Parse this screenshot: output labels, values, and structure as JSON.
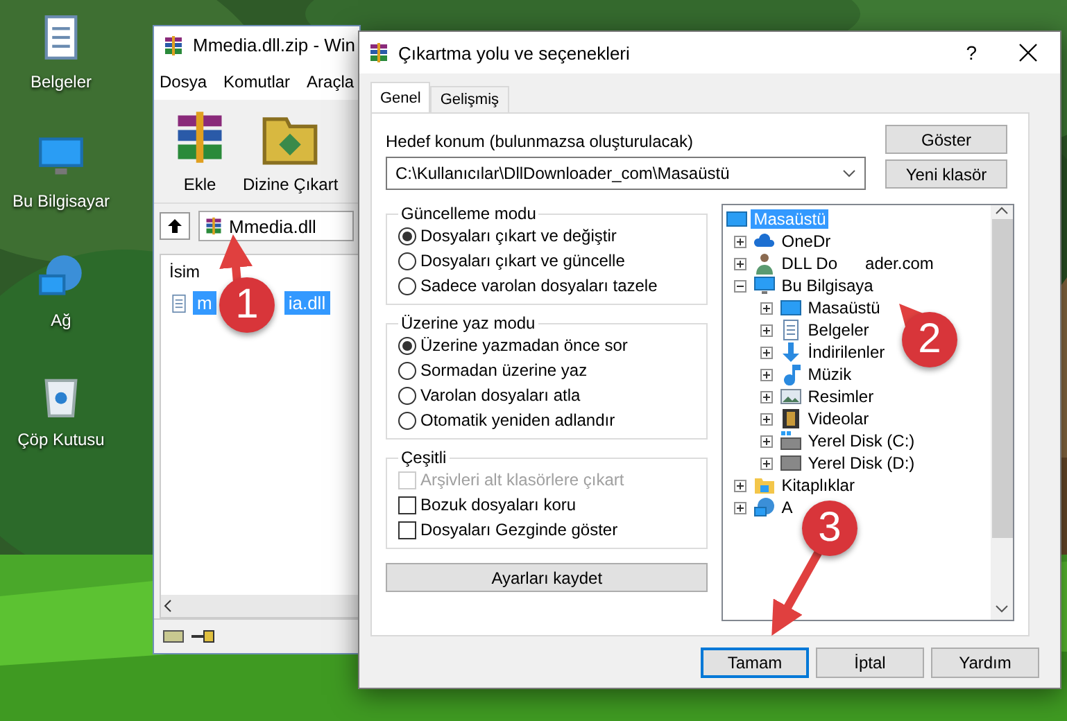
{
  "desktop_icons": [
    {
      "label": "Belgeler",
      "kind": "documents"
    },
    {
      "label": "Bu Bilgisayar",
      "kind": "computer"
    },
    {
      "label": "Ağ",
      "kind": "network"
    },
    {
      "label": "Çöp Kutusu",
      "kind": "recycle"
    }
  ],
  "archive_window": {
    "title": "Mmedia.dll.zip - Win",
    "menu": [
      "Dosya",
      "Komutlar",
      "Araçla"
    ],
    "toolbar": [
      {
        "label": "Ekle",
        "kind": "add"
      },
      {
        "label": "Dizine Çıkart",
        "kind": "extract"
      }
    ],
    "address": "Mmedia.dll",
    "column": "İsim",
    "files": [
      {
        "name": "m",
        "name_tail": "ia.dll",
        "selected": true
      }
    ]
  },
  "dialog": {
    "title": "Çıkartma yolu ve seçenekleri",
    "help": "?",
    "tabs": [
      {
        "label": "Genel",
        "selected": true
      },
      {
        "label": "Gelişmiş",
        "selected": false
      }
    ],
    "destination_label": "Hedef konum (bulunmazsa oluşturulacak)",
    "destination": "C:\\Kullanıcılar\\DllDownloader_com\\Masaüstü",
    "side_buttons": [
      "Göster",
      "Yeni klasör"
    ],
    "groups": [
      {
        "title": "Güncelleme modu",
        "options": [
          {
            "kind": "radio",
            "label": "Dosyaları çıkart ve değiştir",
            "checked": true,
            "disabled": false
          },
          {
            "kind": "radio",
            "label": "Dosyaları çıkart ve güncelle",
            "checked": false,
            "disabled": false
          },
          {
            "kind": "radio",
            "label": "Sadece varolan dosyaları tazele",
            "checked": false,
            "disabled": false
          }
        ]
      },
      {
        "title": "Üzerine yaz modu",
        "options": [
          {
            "kind": "radio",
            "label": "Üzerine yazmadan önce sor",
            "checked": true,
            "disabled": false
          },
          {
            "kind": "radio",
            "label": "Sormadan üzerine yaz",
            "checked": false,
            "disabled": false
          },
          {
            "kind": "radio",
            "label": "Varolan dosyaları atla",
            "checked": false,
            "disabled": false
          },
          {
            "kind": "radio",
            "label": "Otomatik yeniden adlandır",
            "checked": false,
            "disabled": false
          }
        ]
      },
      {
        "title": "Çeşitli",
        "options": [
          {
            "kind": "checkbox",
            "label": "Arşivleri alt klasörlere çıkart",
            "checked": false,
            "disabled": true
          },
          {
            "kind": "checkbox",
            "label": "Bozuk dosyaları koru",
            "checked": false,
            "disabled": false
          },
          {
            "kind": "checkbox",
            "label": "Dosyaları Gezginde göster",
            "checked": false,
            "disabled": false
          }
        ]
      }
    ],
    "save_button": "Ayarları kaydet",
    "tree": {
      "label": "Masaüstü",
      "kind": "desktop",
      "selected": true,
      "children": [
        {
          "label": "OneDr",
          "kind": "cloud",
          "expanded": false,
          "selected": false
        },
        {
          "label": "DLL Do",
          "label_tail": "ader.com",
          "kind": "user",
          "expanded": false,
          "selected": false
        },
        {
          "label": "Bu Bilgisaya",
          "kind": "computer",
          "expanded": true,
          "selected": false,
          "children": [
            {
              "label": "Masaüstü",
              "kind": "desktop",
              "expanded": false,
              "selected": false
            },
            {
              "label": "Belgeler",
              "kind": "documents",
              "expanded": false,
              "selected": false
            },
            {
              "label": "İndirilenler",
              "kind": "download",
              "expanded": false,
              "selected": false
            },
            {
              "label": "Müzik",
              "kind": "music",
              "expanded": false,
              "selected": false
            },
            {
              "label": "Resimler",
              "kind": "pictures",
              "expanded": false,
              "selected": false
            },
            {
              "label": "Videolar",
              "kind": "video",
              "expanded": false,
              "selected": false
            },
            {
              "label": "Yerel Disk (C:)",
              "kind": "system-drive",
              "expanded": false,
              "selected": false
            },
            {
              "label": "Yerel Disk (D:)",
              "kind": "drive",
              "expanded": false,
              "selected": false
            }
          ]
        },
        {
          "label": "Kitaplıklar",
          "kind": "library",
          "expanded": false,
          "selected": false
        },
        {
          "label": "A",
          "kind": "network",
          "expanded": false,
          "selected": false
        }
      ]
    },
    "buttons": [
      {
        "label": "Tamam",
        "default": true
      },
      {
        "label": "İptal",
        "default": false
      },
      {
        "label": "Yardım",
        "default": false
      }
    ]
  },
  "annotations": [
    {
      "label": "1"
    },
    {
      "label": "2"
    },
    {
      "label": "3"
    }
  ]
}
